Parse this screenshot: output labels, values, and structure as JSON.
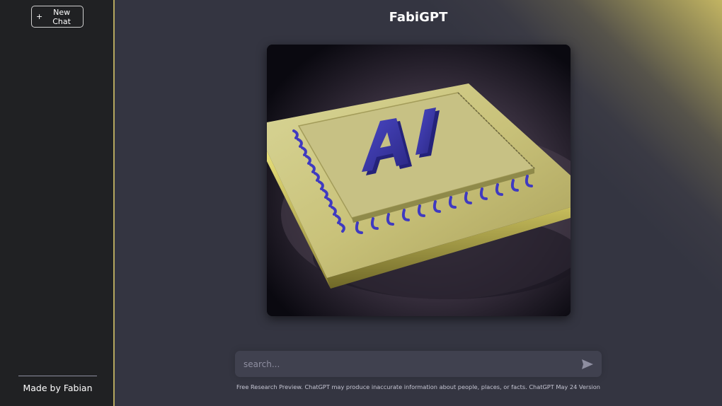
{
  "sidebar": {
    "new_chat_plus": "+",
    "new_chat_label": "New Chat",
    "footer_text": "Made by Fabian"
  },
  "main": {
    "title": "FabiGPT",
    "hero_image_text": "AI",
    "search": {
      "placeholder": "search..."
    },
    "send_icon": "send-icon",
    "disclaimer": "Free Research Preview. ChatGPT may produce inaccurate information about people, places, or facts. ChatGPT May 24 Version"
  },
  "colors": {
    "sidebar_bg": "#202123",
    "main_bg": "#343541",
    "accent_gold": "#c2b462",
    "input_bg": "#40414f",
    "chip_letters": "#3a36a8"
  }
}
